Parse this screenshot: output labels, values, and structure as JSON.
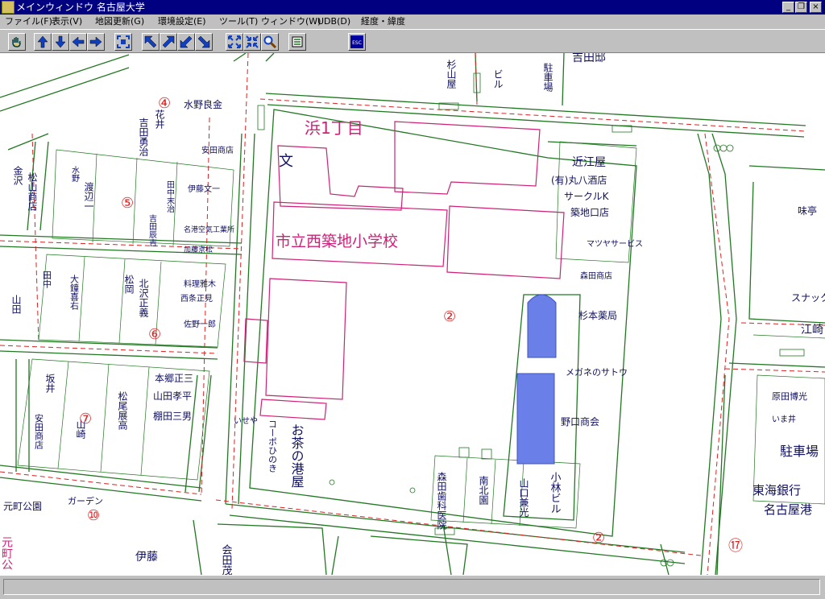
{
  "window": {
    "title": "メインウィンドウ 名古屋大学",
    "minimize_label": "_",
    "restore_label": "❐",
    "close_label": "×"
  },
  "menus": [
    "ファイル(F)",
    "表示(V)",
    "地図更新(G)",
    "環境設定(E)",
    "ツール(T)",
    "ウィンドウ(W)",
    "UDB(D)",
    "経度・緯度"
  ],
  "toolbar": {
    "icons": [
      "hand-icon",
      "arrow-up-icon",
      "arrow-down-icon",
      "arrow-left-icon",
      "arrow-right-icon",
      "fit-view-icon",
      "arrow-up-left-icon",
      "arrow-up-right-icon",
      "arrow-down-left-icon",
      "arrow-down-right-icon",
      "zoom-in-icon",
      "zoom-out-icon",
      "magnifier-icon",
      "layers-icon",
      "esc-icon"
    ],
    "esc_label": "ESC"
  },
  "map": {
    "colors": {
      "road": "#227722",
      "boundary": "#dd2222",
      "building": "#cc2277",
      "water": "#6a7fe8",
      "text": "#101060"
    },
    "district_label": "浜1丁目",
    "school_name": "市立西築地小学校",
    "school_symbol": "文",
    "block_numbers": [
      "④",
      "⑤",
      "⑥",
      "⑦",
      "⑩",
      "⑰",
      "②",
      "②"
    ],
    "labels": [
      {
        "text": "水野良金"
      },
      {
        "text": "安田商店"
      },
      {
        "text": "近江屋"
      },
      {
        "text": "(有)丸八酒店"
      },
      {
        "text": "サークルK"
      },
      {
        "text": "築地口店"
      },
      {
        "text": "伊藤文一"
      },
      {
        "text": "田中末治"
      },
      {
        "text": "吉田辰吉"
      },
      {
        "text": "渡辺一"
      },
      {
        "text": "水野"
      },
      {
        "text": "名港空気工業所"
      },
      {
        "text": "加藤京松"
      },
      {
        "text": "松山商店"
      },
      {
        "text": "金沢"
      },
      {
        "text": "料理雅木"
      },
      {
        "text": "西条正見"
      },
      {
        "text": "佐野一郎"
      },
      {
        "text": "松岡"
      },
      {
        "text": "北沢正義"
      },
      {
        "text": "大鐘喜右"
      },
      {
        "text": "田中"
      },
      {
        "text": "杉本薬局"
      },
      {
        "text": "メガネのサトウ"
      },
      {
        "text": "野口商会"
      },
      {
        "text": "本郷正三"
      },
      {
        "text": "山田孝平"
      },
      {
        "text": "棚田三男"
      },
      {
        "text": "松尾展高"
      },
      {
        "text": "坂井"
      },
      {
        "text": "安田商店"
      },
      {
        "text": "山崎"
      },
      {
        "text": "いせや"
      },
      {
        "text": "コーポひのき"
      },
      {
        "text": "お茶の港屋"
      },
      {
        "text": "森田歯科医院"
      },
      {
        "text": "南北園"
      },
      {
        "text": "山口兼光"
      },
      {
        "text": "小林ビル"
      },
      {
        "text": "駐車場"
      },
      {
        "text": "東海銀行"
      },
      {
        "text": "名古屋港"
      },
      {
        "text": "元町公園"
      },
      {
        "text": "伊藤"
      },
      {
        "text": "会田茂樹"
      },
      {
        "text": "吉田邸"
      },
      {
        "text": "味亭"
      },
      {
        "text": "スナック"
      },
      {
        "text": "江崎"
      },
      {
        "text": "原田博光"
      },
      {
        "text": "いま井"
      },
      {
        "text": "花井"
      },
      {
        "text": "吉田勇治"
      },
      {
        "text": "森田商店"
      },
      {
        "text": "ビル"
      },
      {
        "text": "駐車場"
      },
      {
        "text": "杉山屋"
      },
      {
        "text": "マツヤサービス"
      },
      {
        "text": "山田"
      },
      {
        "text": "ガーデン"
      },
      {
        "text": "元町公"
      }
    ]
  }
}
